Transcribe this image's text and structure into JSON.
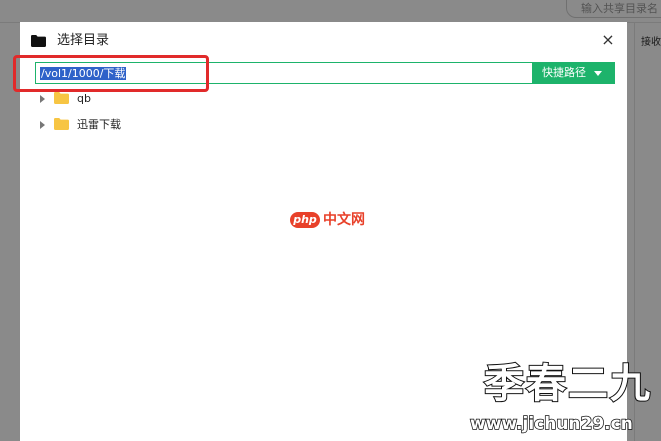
{
  "background": {
    "search_placeholder": "输入共享目录名",
    "right_label": "接收"
  },
  "dialog": {
    "title": "选择目录",
    "close_glyph": "×",
    "path_value": "/vol1/1000/下载",
    "quick_path_label": "快捷路径",
    "tree": [
      {
        "label": "qb"
      },
      {
        "label": "迅雷下载"
      }
    ]
  },
  "watermarks": {
    "php_logo": "php",
    "php_text": "中文网",
    "site_cn": "季春二九",
    "site_url": "www.jichun29.cn"
  },
  "colors": {
    "accent": "#1db36b",
    "highlight": "#e12a2a",
    "folder_dialog_icon": "#111111",
    "folder_tree_icon": "#f7c543"
  }
}
